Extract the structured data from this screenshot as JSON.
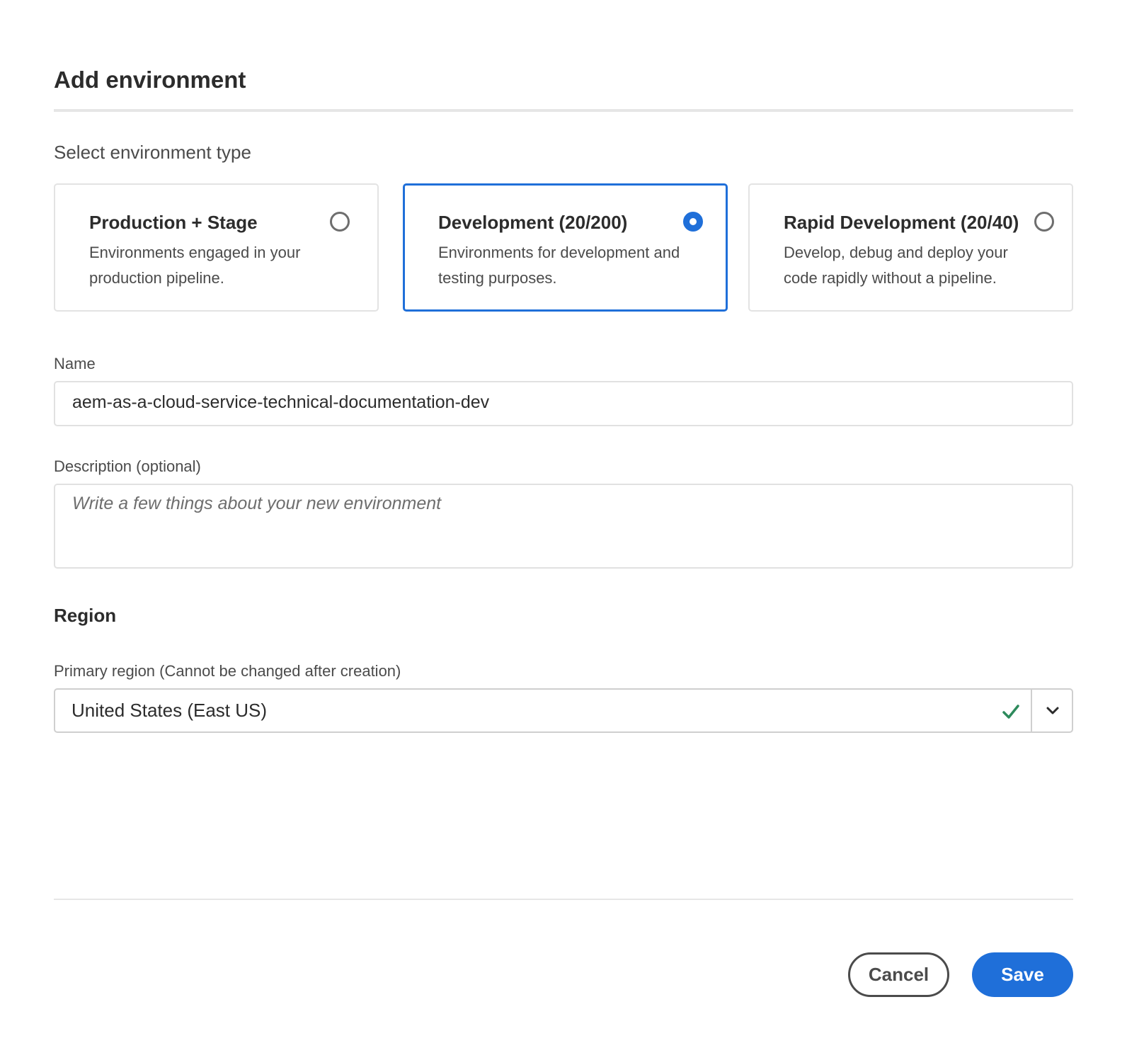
{
  "dialog": {
    "title": "Add environment",
    "section_label": "Select environment type"
  },
  "env_types": [
    {
      "title": "Production + Stage",
      "description": "Environments engaged in your production pipeline.",
      "selected": false
    },
    {
      "title": "Development (20/200)",
      "description": "Environments for development and testing purposes.",
      "selected": true
    },
    {
      "title": "Rapid Development (20/40)",
      "description": "Develop, debug and deploy your code rapidly without a pipeline.",
      "selected": false
    }
  ],
  "name_field": {
    "label": "Name",
    "value": "aem-as-a-cloud-service-technical-documentation-dev"
  },
  "description_field": {
    "label": "Description (optional)",
    "placeholder": "Write a few things about your new environment"
  },
  "region": {
    "heading": "Region",
    "primary_label": "Primary region (Cannot be changed after creation)",
    "selected": "United States (East US)",
    "valid_icon": "checkmark-icon",
    "expand_icon": "chevron-down-icon"
  },
  "footer": {
    "cancel_label": "Cancel",
    "save_label": "Save"
  },
  "colors": {
    "accent": "#1f6fd9",
    "valid": "#2d8a5c",
    "text": "#2c2c2c",
    "muted": "#4b4b4b"
  }
}
